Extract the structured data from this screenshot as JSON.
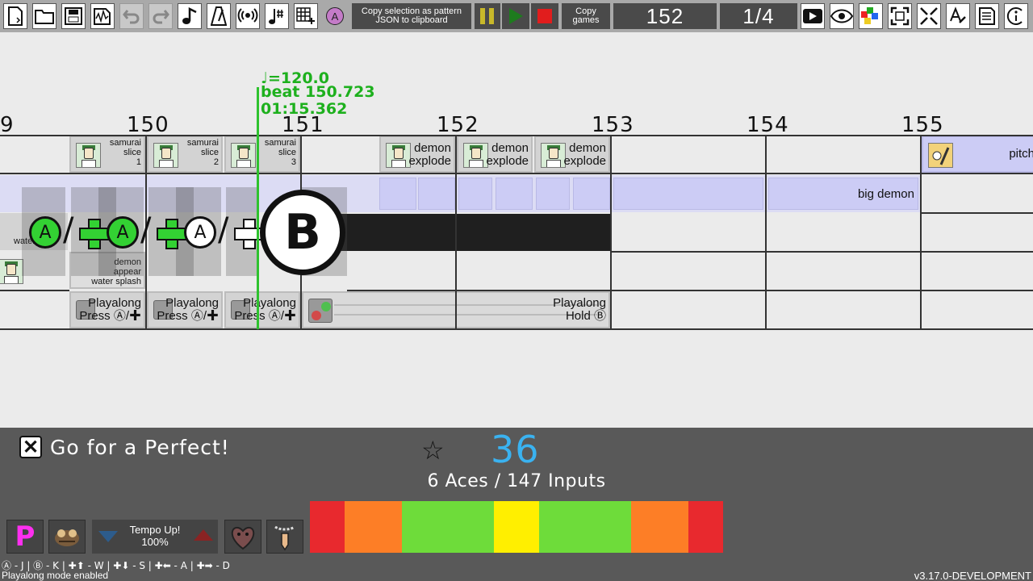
{
  "toolbar": {
    "icons": [
      "new-file",
      "open-folder",
      "save",
      "waveform",
      "undo",
      "redo",
      "music-note",
      "metronome",
      "broadcast",
      "tempo-change",
      "grid",
      "a-button"
    ],
    "copy_pattern": "Copy selection as pattern\nJSON to clipboard",
    "copy_games": "Copy\ngames",
    "beat": "152",
    "snap": "1/4",
    "right_icons": [
      "play-preview",
      "eye",
      "palette",
      "fullscreen",
      "expand",
      "text-edit",
      "list",
      "info"
    ]
  },
  "timeline": {
    "beats": [
      "9",
      "150",
      "151",
      "152",
      "153",
      "154",
      "155"
    ],
    "playhead": {
      "tempo": "♩=120.0",
      "beat": "beat 150.723",
      "time": "01:15.362"
    },
    "row1": [
      {
        "label": "samurai\nslice\n1"
      },
      {
        "label": "samurai\nslice\n2"
      },
      {
        "label": "samurai\nslice\n3"
      },
      {
        "label": "demon\nexplode"
      },
      {
        "label": "demon\nexplode"
      },
      {
        "label": "demon\nexplode"
      },
      {
        "label": "pitch"
      }
    ],
    "big_demon": "big demon",
    "water_label": "water",
    "row3": {
      "label": "demon\nappear\nwater splash"
    },
    "playalong": [
      {
        "label": "Playalong\nPress Ⓐ/✚"
      },
      {
        "label": "Playalong\nPress Ⓐ/✚"
      },
      {
        "label": "Playalong\nPress Ⓐ/✚"
      },
      {
        "label": "Playalong\nHold Ⓑ"
      }
    ],
    "input_glyphs": {
      "a": "A",
      "b": "B",
      "slash": "/"
    }
  },
  "bottom": {
    "goal": "Go for a Perfect!",
    "star": "☆",
    "score": "36",
    "aces": "6 Aces / 147 Inputs",
    "tempo_label": "Tempo Up!",
    "tempo_value": "100%",
    "p_badge": "P",
    "meter_colors": [
      "#e8292e",
      "#fd7e26",
      "#6edc3a",
      "#ffef00",
      "#6edc3a",
      "#fd7e26",
      "#e8292e"
    ],
    "keys": "Ⓐ - J  |  Ⓑ - K  |  ✚⬆ - W  |  ✚⬇ - S  |  ✚⬅ - A  |  ✚➡ - D",
    "mode": "Playalong mode enabled",
    "version": "v3.17.0-DEVELOPMENT"
  }
}
